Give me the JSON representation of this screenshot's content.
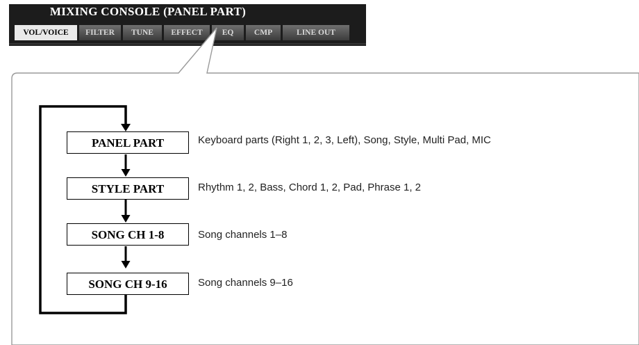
{
  "console": {
    "title": "MIXING CONSOLE (PANEL PART)",
    "tabs": [
      "VOL/VOICE",
      "FILTER",
      "TUNE",
      "EFFECT",
      "EQ",
      "CMP",
      "LINE OUT"
    ],
    "active_tab": "VOL/VOICE"
  },
  "parts": [
    {
      "label": "PANEL PART",
      "description": "Keyboard parts (Right 1, 2, 3, Left), Song, Style, Multi Pad, MIC"
    },
    {
      "label": "STYLE PART",
      "description": "Rhythm 1, 2, Bass, Chord 1, 2, Pad, Phrase 1, 2"
    },
    {
      "label": "SONG CH 1-8",
      "description": "Song channels 1–8"
    },
    {
      "label": "SONG CH 9-16",
      "description": "Song channels 9–16"
    }
  ]
}
